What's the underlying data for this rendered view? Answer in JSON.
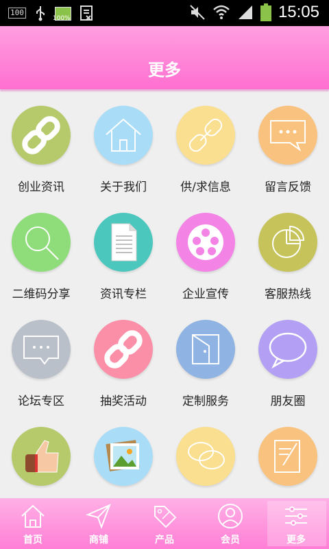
{
  "status": {
    "signal_box": "100",
    "battery_percent": "100%",
    "time": "15:05"
  },
  "header": {
    "title": "更多"
  },
  "grid": [
    {
      "label": "创业资讯",
      "icon": "chain-link-icon",
      "color": "#b6c96b"
    },
    {
      "label": "关于我们",
      "icon": "house-icon",
      "color": "#a9ddf7"
    },
    {
      "label": "供/求信息",
      "icon": "broken-link-icon",
      "color": "#f9df8f"
    },
    {
      "label": "留言反馈",
      "icon": "speech-bubble-icon",
      "color": "#f9c27e"
    },
    {
      "label": "二维码分享",
      "icon": "magnifier-icon",
      "color": "#8fdc7a"
    },
    {
      "label": "资讯专栏",
      "icon": "document-icon",
      "color": "#4cc7bd"
    },
    {
      "label": "企业宣传",
      "icon": "film-reel-icon",
      "color": "#f384e6"
    },
    {
      "label": "客服热线",
      "icon": "pie-chart-icon",
      "color": "#c6c35a"
    },
    {
      "label": "论坛专区",
      "icon": "chat-bubble-icon",
      "color": "#b9c0c9"
    },
    {
      "label": "抽奖活动",
      "icon": "chain-link-icon",
      "color": "#fb8fa8"
    },
    {
      "label": "定制服务",
      "icon": "wallet-icon",
      "color": "#8fb3e3"
    },
    {
      "label": "朋友圈",
      "icon": "oval-bubble-icon",
      "color": "#b39ff3"
    },
    {
      "label": "",
      "icon": "thumbs-up-icon",
      "color": "#b6c96b"
    },
    {
      "label": "",
      "icon": "picture-icon",
      "color": "#a9ddf7"
    },
    {
      "label": "",
      "icon": "double-bubble-icon",
      "color": "#f9df8f"
    },
    {
      "label": "",
      "icon": "edit-note-icon",
      "color": "#f9c27e"
    }
  ],
  "tabs": [
    {
      "label": "首页",
      "icon": "home-icon"
    },
    {
      "label": "商铺",
      "icon": "paper-plane-icon"
    },
    {
      "label": "产品",
      "icon": "sale-tag-icon"
    },
    {
      "label": "会员",
      "icon": "user-icon"
    },
    {
      "label": "更多",
      "icon": "sliders-icon",
      "active": true
    }
  ]
}
